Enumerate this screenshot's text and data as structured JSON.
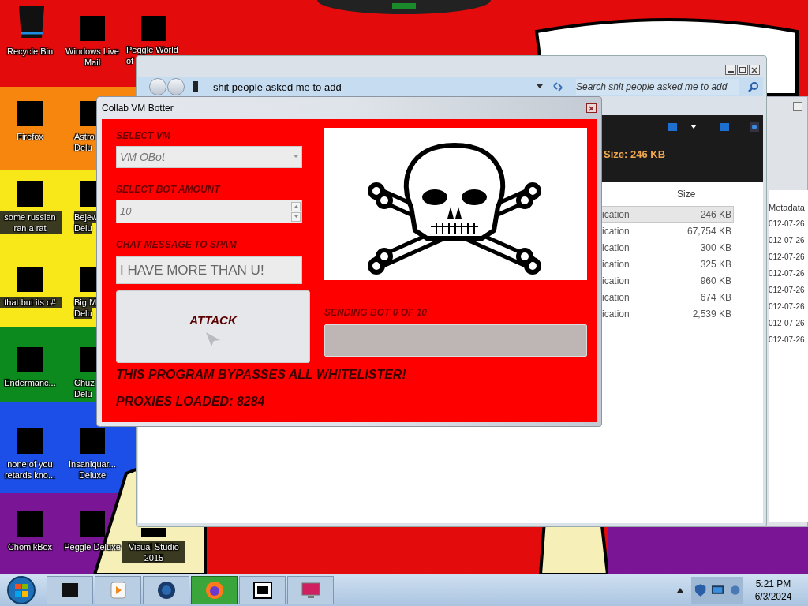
{
  "desktop_icons": [
    {
      "kind": "bin",
      "lines": [
        "Recycle Bin"
      ]
    },
    {
      "kind": "redacted",
      "lines": [
        "Windows Live",
        "Mail"
      ]
    },
    {
      "kind": "redacted",
      "lines": [
        "Peggle World",
        "of"
      ]
    },
    {
      "kind": "redacted",
      "lines": [
        "Firefox"
      ]
    },
    {
      "kind": "redacted",
      "lines": [
        "Astro",
        "Delu"
      ]
    },
    {
      "kind": "redacted",
      "lines": [
        "some russian",
        "ran a rat"
      ]
    },
    {
      "kind": "redacted",
      "lines": [
        "Bejew",
        "Delu"
      ]
    },
    {
      "kind": "redacted",
      "lines": [
        "that but its c#"
      ]
    },
    {
      "kind": "redacted",
      "lines": [
        "Big M",
        "Delu"
      ]
    },
    {
      "kind": "redacted",
      "lines": [
        "Endermanc..."
      ]
    },
    {
      "kind": "redacted",
      "lines": [
        "Chuz",
        "Delu"
      ]
    },
    {
      "kind": "redacted",
      "lines": [
        "none of you",
        "retards kno..."
      ]
    },
    {
      "kind": "redacted",
      "lines": [
        "Insaniquar...",
        "Deluxe"
      ]
    },
    {
      "kind": "redacted",
      "lines": [
        "ChomikBox"
      ]
    },
    {
      "kind": "redacted",
      "lines": [
        "Peggle Deluxe"
      ]
    },
    {
      "kind": "redacted",
      "lines": [
        "Visual Studio",
        "2015"
      ]
    }
  ],
  "explorer": {
    "address": "shit people asked me to add",
    "search": {
      "placeholder": "Search shit people asked me to add"
    },
    "details": "Size: 246 KB",
    "size_column": "Size",
    "rows": [
      {
        "type": "ication",
        "size": "246 KB",
        "selected": true
      },
      {
        "type": "ication",
        "size": "67,754 KB",
        "selected": false
      },
      {
        "type": "ication",
        "size": "300 KB",
        "selected": false
      },
      {
        "type": "ication",
        "size": "325 KB",
        "selected": false
      },
      {
        "type": "ication",
        "size": "960 KB",
        "selected": false
      },
      {
        "type": "ication",
        "size": "674 KB",
        "selected": false
      },
      {
        "type": "ication",
        "size": "2,539 KB",
        "selected": false
      }
    ]
  },
  "back_window": {
    "column": "Metadata",
    "rows": [
      "012-07-26",
      "012-07-26",
      "012-07-26",
      "012-07-26",
      "012-07-26",
      "012-07-26",
      "012-07-26",
      "012-07-26"
    ]
  },
  "botter": {
    "title": "Collab VM Botter",
    "vm_label": "SELECT VM",
    "vm_value": "VM OBot",
    "amount_label": "SELECT BOT AMOUNT",
    "amount_value": "10",
    "message_label": "CHAT MESSAGE TO SPAM",
    "message_value": "I HAVE MORE THAN U!",
    "attack_button": "ATTACK",
    "progress_label": "SENDING BOT 0 OF 10",
    "progress": {
      "level": 0
    },
    "notes": [
      "THIS PROGRAM BYPASSES ALL WHITELISTER!",
      "PROXIES LOADED: 8284"
    ]
  },
  "taskbar": {
    "items": [
      {
        "kind": "box",
        "selected": false
      },
      {
        "kind": "media",
        "selected": false
      },
      {
        "kind": "globe",
        "selected": false
      },
      {
        "kind": "firefox",
        "selected": true
      },
      {
        "kind": "archive",
        "selected": false
      },
      {
        "kind": "monitor",
        "selected": false
      }
    ],
    "time": "5:21 PM",
    "date": "6/3/2024"
  }
}
